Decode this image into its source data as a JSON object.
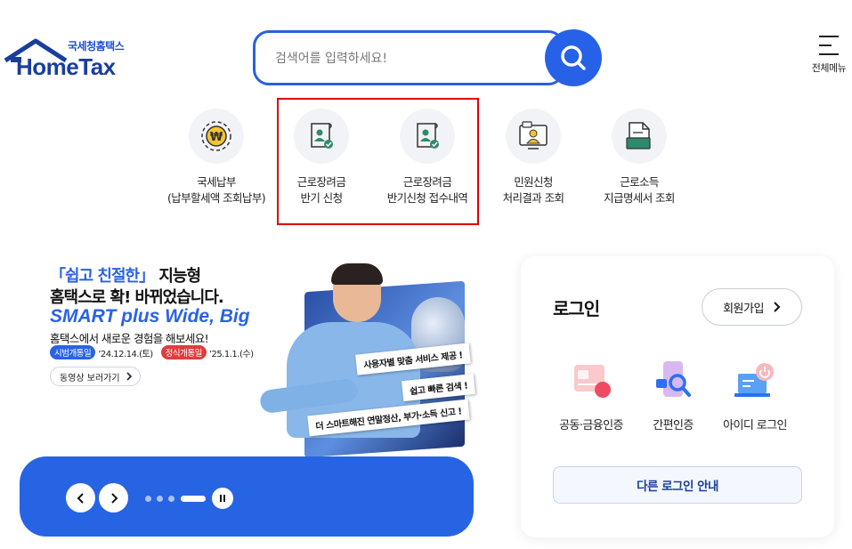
{
  "header": {
    "logo_sub": "국세청홈택스",
    "logo_main": "HomeTax",
    "search_placeholder": "검색어를 입력하세요!",
    "menu_label": "전체메뉴"
  },
  "quick_menu": [
    {
      "icon": "won-coin-icon",
      "line1": "국세납부",
      "line2": "(납부할세액 조회납부)"
    },
    {
      "icon": "document-person-icon",
      "line1": "근로장려금",
      "line2": "반기 신청"
    },
    {
      "icon": "document-person-icon",
      "line1": "근로장려금",
      "line2": "반기신청 접수내역"
    },
    {
      "icon": "monitor-person-icon",
      "line1": "민원신청",
      "line2": "처리결과 조회"
    },
    {
      "icon": "document-stack-icon",
      "line1": "근로소득",
      "line2": "지급명세서 조회"
    }
  ],
  "banner": {
    "line1_prefix": "「쉽고 친절한」",
    "line1_suffix": " 지능형",
    "line2": "홈택스로 확! 바뀌었습니다.",
    "line3": "SMART plus Wide, Big",
    "line4": "홈택스에서 새로운 경험을 해보세요!",
    "pilot_label": "시범개통일",
    "pilot_date": "’24.12.14.(토)",
    "official_label": "정식개통일",
    "official_date": "’25.1.1.(수)",
    "video_button": "동영상 보러가기",
    "speech1": "사용자별 맞춤 서비스 제공 !",
    "speech2": "쉽고 빠른 검색 !",
    "speech3": "더 스마트해진 연말정산, 부가·소득 신고 !"
  },
  "login": {
    "title": "로그인",
    "signup_button": "회원가입",
    "methods": [
      {
        "icon": "certificate-card-icon",
        "label": "공동·금융인증"
      },
      {
        "icon": "phone-search-icon",
        "label": "간편인증"
      },
      {
        "icon": "laptop-power-icon",
        "label": "아이디 로그인"
      }
    ],
    "other_login": "다른 로그인 안내"
  },
  "colors": {
    "brand_blue": "#2661e8",
    "highlight_red": "#e10000"
  }
}
